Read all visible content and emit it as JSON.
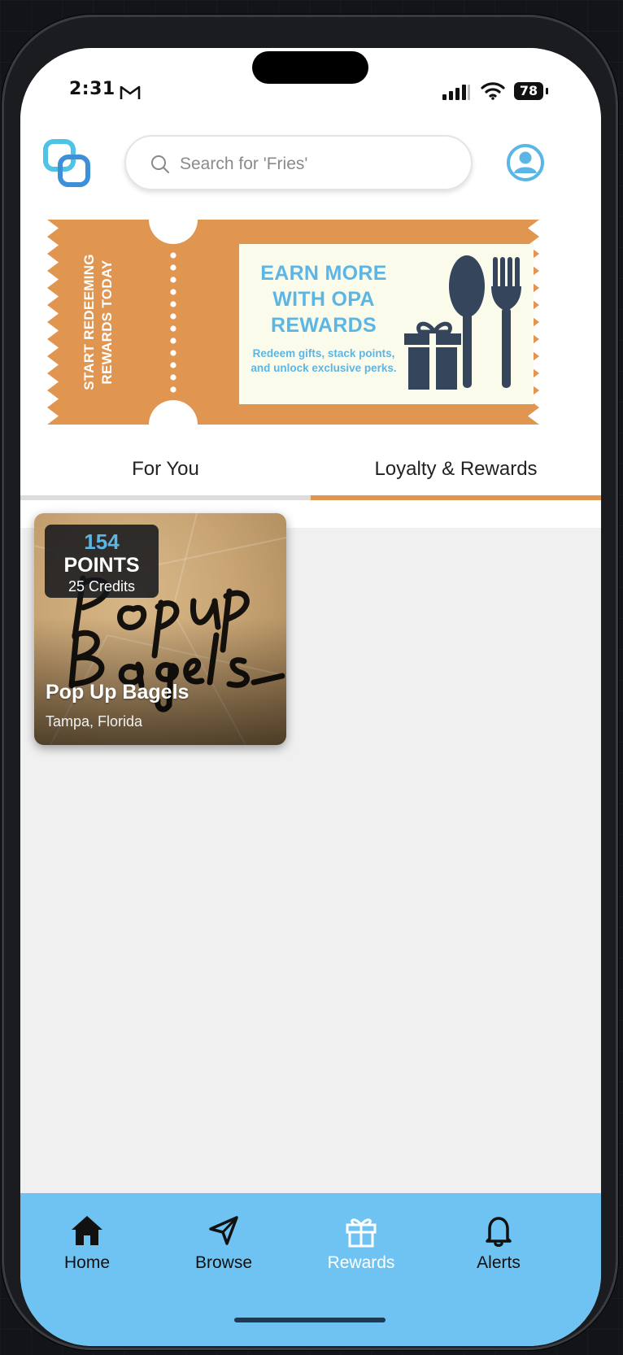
{
  "status_bar": {
    "time": "2:31",
    "battery": "78"
  },
  "search": {
    "placeholder": "Search for 'Fries'"
  },
  "banner": {
    "side_text_line1": "START REDEEMING",
    "side_text_line2": "REWARDS TODAY",
    "title_line1": "EARN MORE",
    "title_line2": "WITH OPA",
    "title_line3": "REWARDS",
    "subtitle_line1": "Redeem gifts, stack points,",
    "subtitle_line2": "and unlock exclusive perks.",
    "color": "#e09650"
  },
  "tabs": [
    {
      "label": "For You",
      "active": false
    },
    {
      "label": "Loyalty & Rewards",
      "active": true
    }
  ],
  "rewards_cards": [
    {
      "points_value": "154",
      "points_label": "POINTS",
      "credits": "25 Credits",
      "name": "Pop Up Bagels",
      "location": "Tampa, Florida"
    }
  ],
  "bottom_nav": [
    {
      "label": "Home",
      "icon": "home-icon"
    },
    {
      "label": "Browse",
      "icon": "send-icon"
    },
    {
      "label": "Rewards",
      "icon": "gift-icon",
      "active": true
    },
    {
      "label": "Alerts",
      "icon": "bell-icon"
    }
  ],
  "colors": {
    "accent": "#5cb6e5",
    "nav_bg": "#6ec3f2",
    "tab_active": "#e09650"
  }
}
